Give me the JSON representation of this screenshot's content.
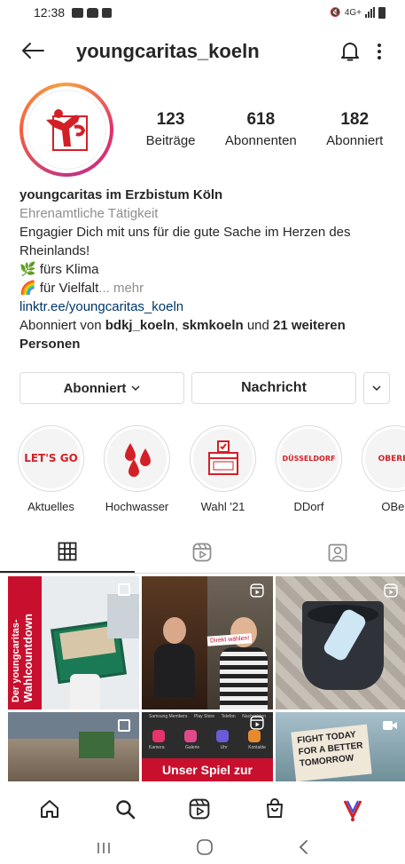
{
  "status_bar": {
    "time": "12:38",
    "network": "4G+"
  },
  "header": {
    "username": "youngcaritas_koeln"
  },
  "profile": {
    "stats": [
      {
        "value": "123",
        "label": "Beiträge"
      },
      {
        "value": "618",
        "label": "Abonnenten"
      },
      {
        "value": "182",
        "label": "Abonniert"
      }
    ]
  },
  "bio": {
    "name": "youngcaritas im Erzbistum Köln",
    "category": "Ehrenamtliche Tätigkeit",
    "line1": "Engagier Dich mit uns für die gute Sache im Herzen des Rheinlands!",
    "line2": "🌿 fürs Klima",
    "line3": "🌈 für Vielfalt",
    "more": "... mehr",
    "link": "linktr.ee/youngcaritas_koeln",
    "followed_prefix": "Abonniert von",
    "followed_user1": "bdkj_koeln",
    "followed_user2": "skmkoeln",
    "followed_and": "und",
    "followed_others": "21 weiteren Personen"
  },
  "actions": {
    "follow_label": "Abonniert",
    "message_label": "Nachricht"
  },
  "highlights": [
    {
      "label": "Aktuelles",
      "cover_text": "LET'S GO"
    },
    {
      "label": "Hochwasser"
    },
    {
      "label": "Wahl '21",
      "cover_text": "VOTE"
    },
    {
      "label": "DDorf",
      "cover_text": "DÜSSELDORF"
    },
    {
      "label": "OBer",
      "cover_text": "OBERBI"
    }
  ],
  "posts": [
    {
      "text1": "Der youngcaritas-",
      "text2": "Wahlcountdown"
    },
    {
      "text": "Direkt wählen!"
    },
    {},
    {},
    {
      "text": "Unser Spiel zur",
      "menu": [
        "Samsung Members",
        "Play Store",
        "Telefon",
        "Nachrichten",
        "Kamera",
        "Galerie",
        "Uhr",
        "Kontakte"
      ]
    },
    {
      "text": "FIGHT TODAY FOR A BETTER TOMORROW"
    }
  ],
  "colors": {
    "brand_red": "#d32027",
    "link_blue": "#00376b",
    "muted": "#8e8e8e",
    "border": "#dbdbdb"
  }
}
